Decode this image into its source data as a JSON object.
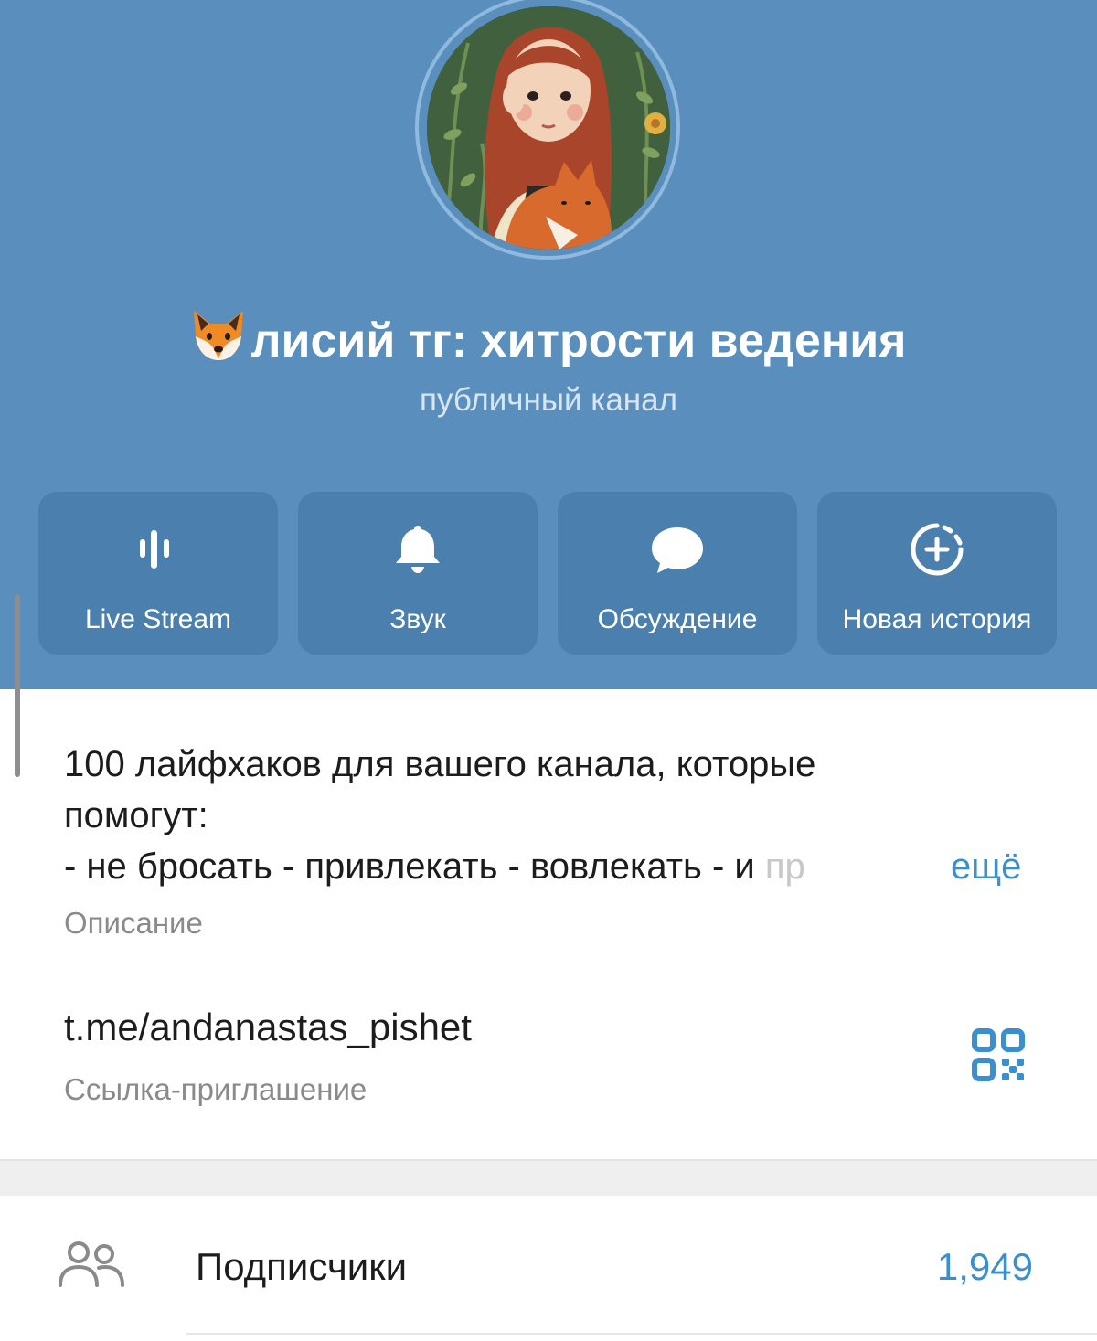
{
  "channel": {
    "title_emoji_icon": "fox-face-icon",
    "title": "лисий тг: хитрости ведения",
    "subtitle": "публичный канал"
  },
  "actions": [
    {
      "label": "Live Stream",
      "icon": "live-stream-icon"
    },
    {
      "label": "Звук",
      "icon": "bell-icon"
    },
    {
      "label": "Обсуждение",
      "icon": "chat-bubble-icon"
    },
    {
      "label": "Новая история",
      "icon": "add-story-icon"
    }
  ],
  "description": {
    "line1": "100 лайфхаков для вашего канала, которые",
    "line2": "помогут:",
    "line3": "- не бросать - привлекать - вовлекать - и",
    "line3_fade": " пр",
    "more": "ещё",
    "label": "Описание"
  },
  "invite": {
    "link": "t.me/andanastas_pishet",
    "label": "Ссылка-приглашение",
    "qr_icon": "qr-code-icon"
  },
  "subscribers": {
    "label": "Подписчики",
    "count": "1,949",
    "icon": "people-icon"
  },
  "colors": {
    "header_bg": "#5a8ebc",
    "button_bg": "#4b7fad",
    "accent": "#3a8fd0"
  }
}
